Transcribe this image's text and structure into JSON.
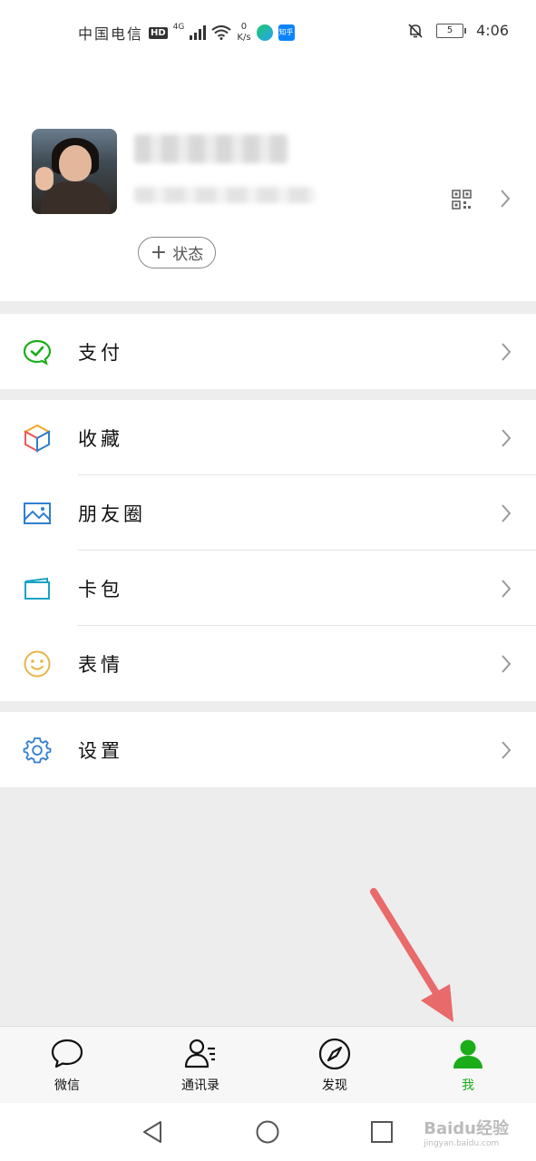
{
  "status_bar": {
    "carrier": "中国电信",
    "hd": "HD",
    "network": "4G",
    "speed_value": "0",
    "speed_unit": "K/s",
    "zhihu": "知乎",
    "battery": "5",
    "time": "4:06"
  },
  "profile": {
    "status_button_label": "状态"
  },
  "menu": {
    "pay": "支付",
    "favorites": "收藏",
    "moments": "朋友圈",
    "cards": "卡包",
    "stickers": "表情",
    "settings": "设置"
  },
  "bottom_nav": {
    "tabs": [
      {
        "label": "微信",
        "icon": "chat-bubble-icon",
        "active": false
      },
      {
        "label": "通讯录",
        "icon": "contacts-icon",
        "active": false
      },
      {
        "label": "发现",
        "icon": "compass-icon",
        "active": false
      },
      {
        "label": "我",
        "icon": "person-icon",
        "active": true
      }
    ]
  },
  "watermark": {
    "brand": "Baidu经验",
    "url": "jingyan.baidu.com"
  },
  "colors": {
    "active_green": "#1aad19",
    "pay_green": "#1aad19",
    "favorites_multicolor": "#f6a623",
    "moments_blue": "#2f7fd1",
    "cards_teal": "#18a3c4",
    "stickers_yellow": "#e8b54a",
    "settings_blue": "#2f7fd1",
    "annotation_arrow": "#e86a6a"
  }
}
